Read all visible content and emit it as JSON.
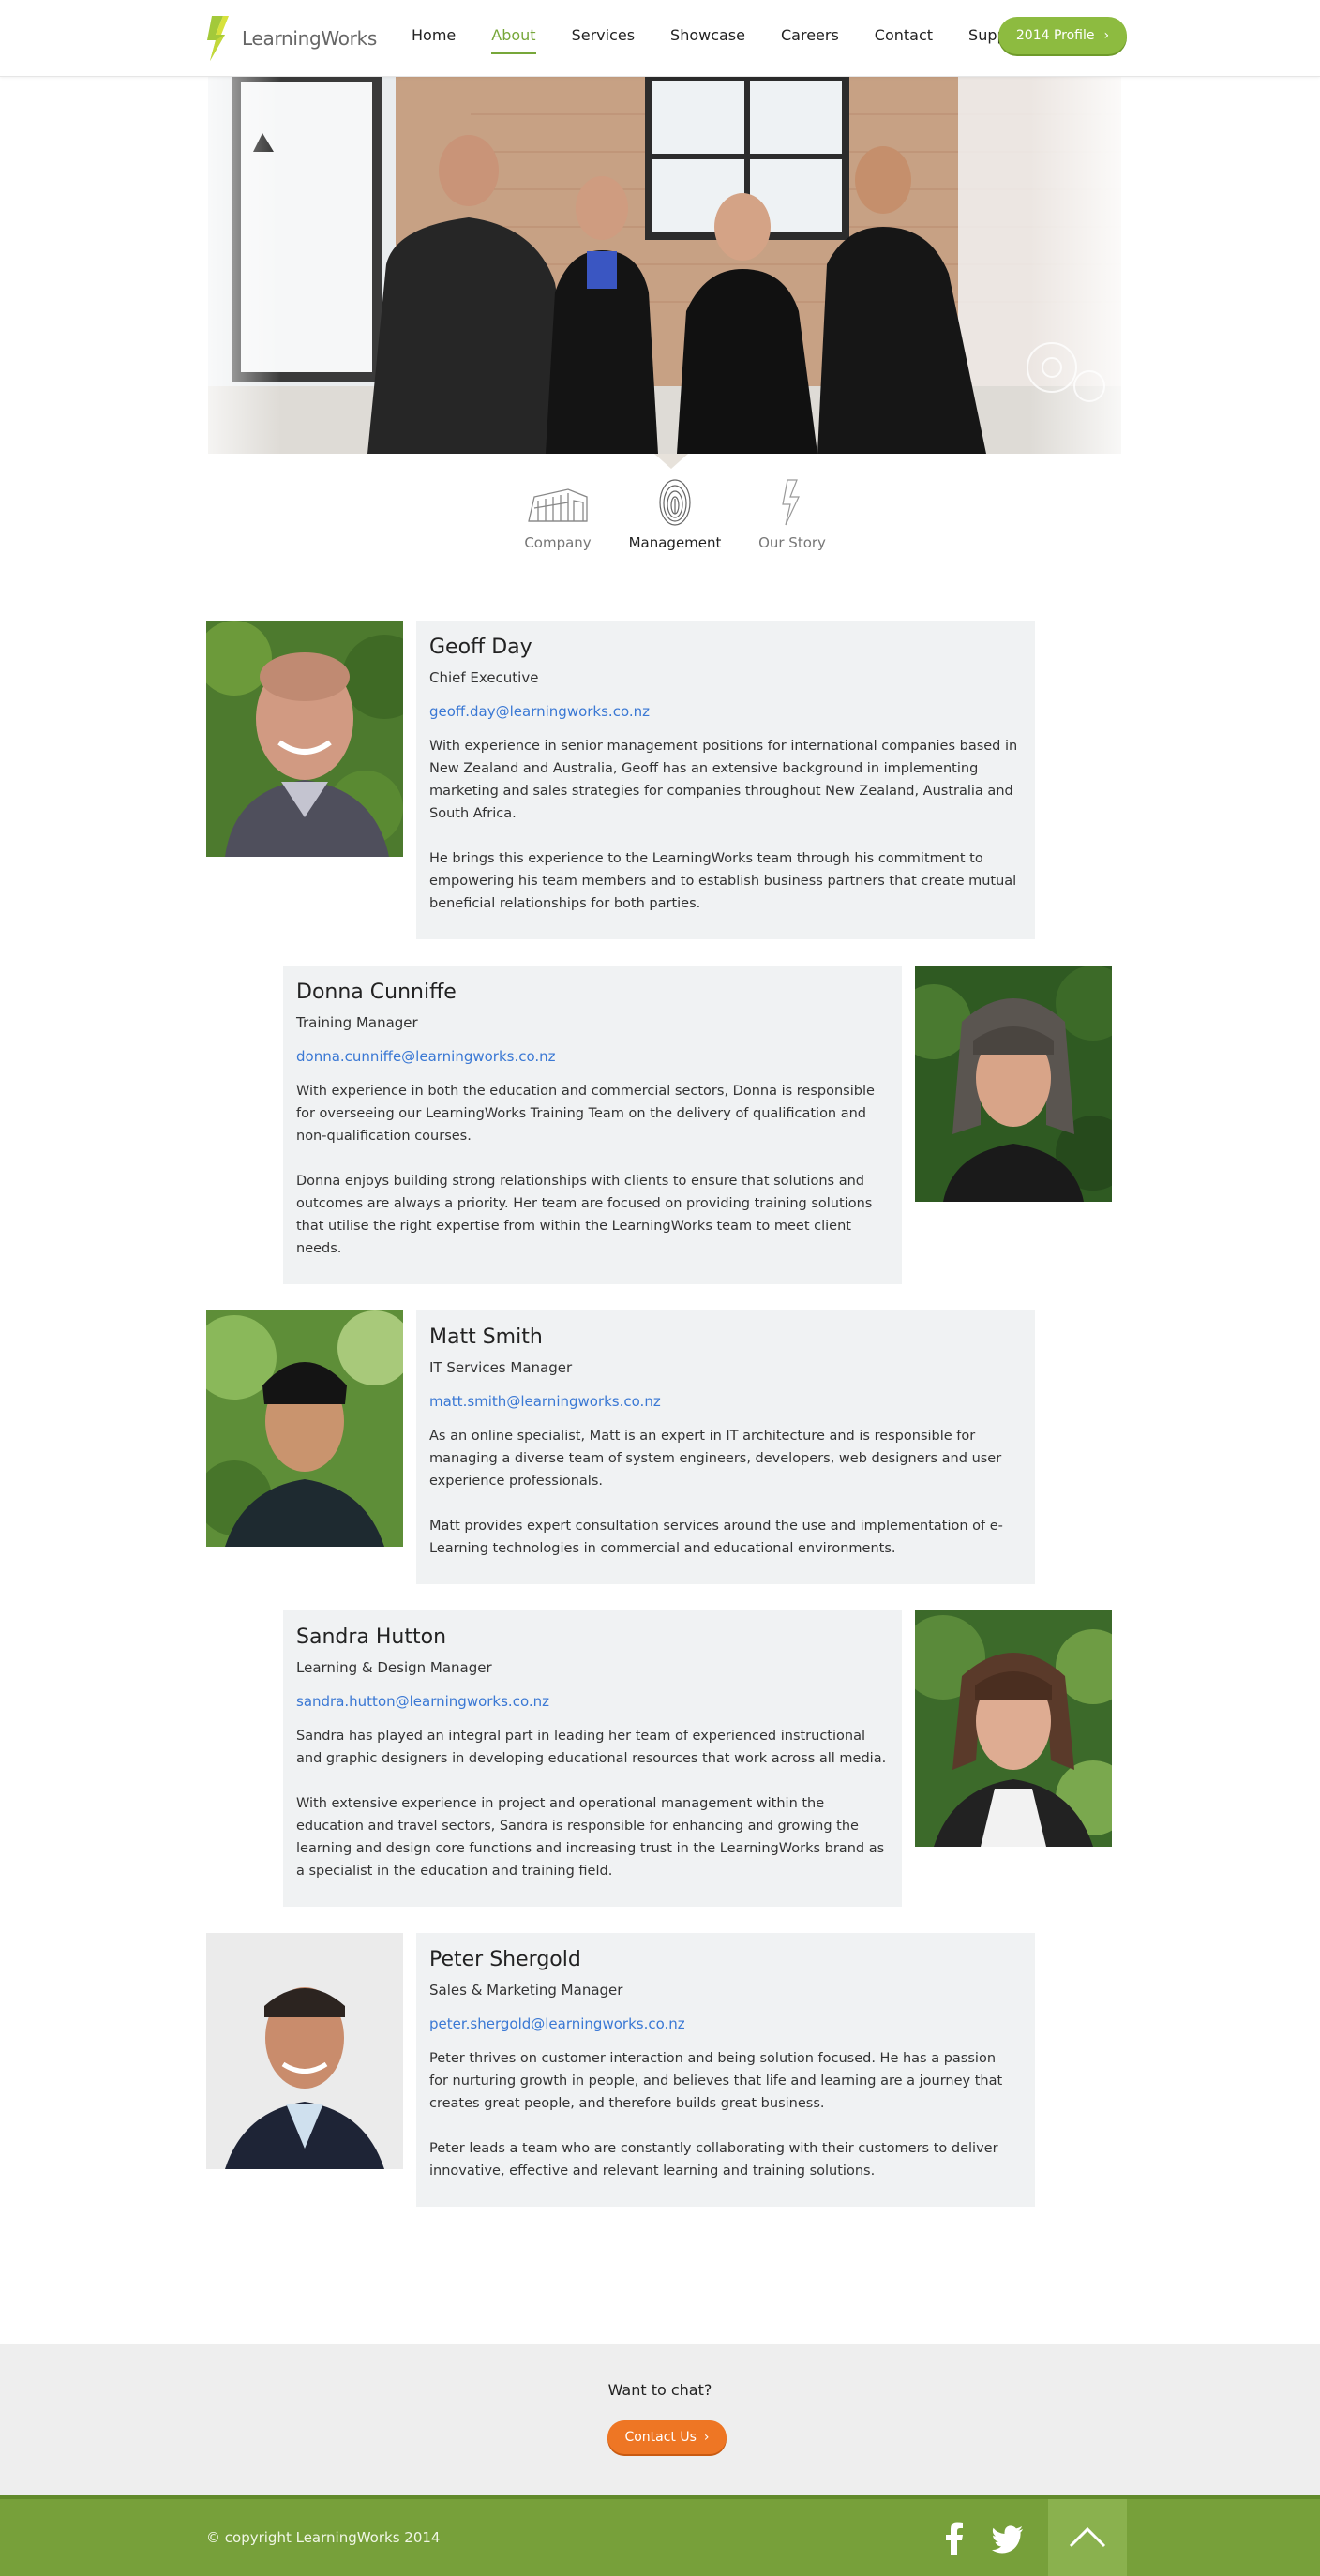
{
  "brand": {
    "name": "LearningWorks"
  },
  "nav": {
    "items": [
      {
        "label": "Home"
      },
      {
        "label": "About"
      },
      {
        "label": "Services"
      },
      {
        "label": "Showcase"
      },
      {
        "label": "Careers"
      },
      {
        "label": "Contact"
      },
      {
        "label": "Support"
      }
    ],
    "active": "About",
    "profile_button": "2014 Profile"
  },
  "subtabs": [
    {
      "label": "Company",
      "icon": "building-icon"
    },
    {
      "label": "Management",
      "icon": "fingerprint-icon"
    },
    {
      "label": "Our Story",
      "icon": "logo-outline-icon"
    }
  ],
  "subtabs_active": "Management",
  "people": [
    {
      "name": "Geoff Day",
      "role": "Chief Executive",
      "email": "geoff.day@learningworks.co.nz",
      "para1": [
        "With experience in senior management positions for international companies based in",
        "New Zealand and Australia, Geoff has an extensive background in implementing",
        "marketing and sales strategies for companies throughout New Zealand, Australia and",
        "South Africa."
      ],
      "para2": [
        "He brings this experience to the LearningWorks team through his commitment to",
        "empowering his team members and to establish business partners that create mutual",
        "beneficial relationships for both parties."
      ]
    },
    {
      "name": "Donna Cunniffe",
      "role": "Training Manager",
      "email": "donna.cunniffe@learningworks.co.nz",
      "para1": [
        "With experience in both the education and commercial sectors, Donna is responsible",
        "for overseeing our LearningWorks Training Team on the delivery of qualification and",
        "non-qualification courses."
      ],
      "para2": [
        "Donna enjoys building strong relationships with clients to ensure that solutions and",
        "outcomes are always a priority. Her team are focused on providing training solutions",
        "that utilise the right expertise from within the LearningWorks team to meet client",
        "needs."
      ]
    },
    {
      "name": "Matt Smith",
      "role": "IT Services Manager",
      "email": "matt.smith@learningworks.co.nz",
      "para1": [
        "As an online specialist, Matt is an expert in IT architecture and is responsible for",
        "managing a diverse team of system engineers, developers, web designers and user",
        "experience professionals."
      ],
      "para2": [
        "Matt provides expert consultation services around the use and implementation of e-",
        "Learning technologies in commercial and educational environments."
      ]
    },
    {
      "name": "Sandra Hutton",
      "role": "Learning & Design Manager",
      "email": "sandra.hutton@learningworks.co.nz",
      "para1": [
        "Sandra has played an integral part in leading her team of experienced instructional",
        "and graphic designers in developing educational resources that work across all media."
      ],
      "para2": [
        "With extensive experience in project and operational management within the",
        "education and travel sectors, Sandra is responsible for enhancing and growing the",
        "learning and design core functions and increasing trust in the LearningWorks brand as",
        "a specialist in the education and training field."
      ]
    },
    {
      "name": "Peter Shergold",
      "role": "Sales & Marketing Manager",
      "email": "peter.shergold@learningworks.co.nz",
      "para1": [
        "Peter thrives on customer interaction and being solution focused. He has a passion",
        "for nurturing growth in people, and believes that life and learning are a journey that",
        "creates great people, and therefore builds great business."
      ],
      "para2": [
        "Peter leads a team who are constantly collaborating with their customers to deliver",
        "innovative, effective and relevant learning and training solutions."
      ]
    }
  ],
  "cta": {
    "question": "Want to chat?",
    "button": "Contact Us"
  },
  "footer": {
    "copyright": "© copyright LearningWorks 2014"
  },
  "colors": {
    "brand_green": "#8dbb40",
    "link_blue": "#3a78d4",
    "cta_orange": "#ee7624",
    "footer_green": "#77a03a"
  }
}
